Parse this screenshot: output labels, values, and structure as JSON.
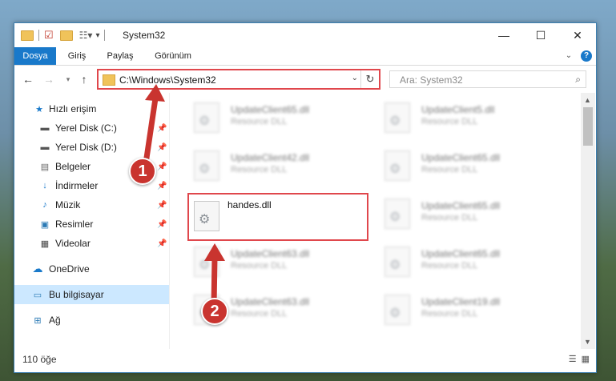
{
  "window": {
    "title": "System32",
    "controls": {
      "minimize": "—",
      "maximize": "☐",
      "close": "✕"
    }
  },
  "ribbon": {
    "tabs": [
      {
        "label": "Dosya",
        "active": true
      },
      {
        "label": "Giriş"
      },
      {
        "label": "Paylaş"
      },
      {
        "label": "Görünüm"
      }
    ],
    "expand_icon": "chevron-down-icon",
    "help_icon": "help-icon"
  },
  "navigation": {
    "address": "C:\\Windows\\System32",
    "search_placeholder": "Ara: System32"
  },
  "sidebar": {
    "items": [
      {
        "label": "Hızlı erişim",
        "icon": "star-icon",
        "pinned": false
      },
      {
        "label": "Yerel Disk (C:)",
        "icon": "drive-icon",
        "pinned": true
      },
      {
        "label": "Yerel Disk (D:)",
        "icon": "drive-icon",
        "pinned": true
      },
      {
        "label": "Belgeler",
        "icon": "documents-icon",
        "pinned": true
      },
      {
        "label": "İndirmeler",
        "icon": "download-icon",
        "pinned": true
      },
      {
        "label": "Müzik",
        "icon": "music-icon",
        "pinned": true
      },
      {
        "label": "Resimler",
        "icon": "pictures-icon",
        "pinned": true
      },
      {
        "label": "Videolar",
        "icon": "videos-icon",
        "pinned": true
      },
      {
        "label": "OneDrive",
        "icon": "cloud-icon"
      },
      {
        "label": "Bu bilgisayar",
        "icon": "computer-icon",
        "selected": true
      },
      {
        "label": "Ağ",
        "icon": "network-icon"
      }
    ]
  },
  "files": [
    {
      "name": "UpdateClient65.dll",
      "type": "Resource DLL",
      "blurred": true
    },
    {
      "name": "UpdateClient5.dll",
      "type": "Resource DLL",
      "blurred": true
    },
    {
      "name": "UpdateClient42.dll",
      "type": "Resource DLL",
      "blurred": true
    },
    {
      "name": "UpdateClient65.dll",
      "type": "Resource DLL",
      "blurred": true
    },
    {
      "name": "handes.dll",
      "type": "",
      "blurred": false,
      "highlighted": true
    },
    {
      "name": "UpdateClient65.dll",
      "type": "Resource DLL",
      "blurred": true
    },
    {
      "name": "UpdateClient63.dll",
      "type": "Resource DLL",
      "blurred": true
    },
    {
      "name": "UpdateClient65.dll",
      "type": "Resource DLL",
      "blurred": true
    },
    {
      "name": "UpdateClient63.dll",
      "type": "Resource DLL",
      "blurred": true
    },
    {
      "name": "UpdateClient19.dll",
      "type": "Resource DLL",
      "blurred": true
    }
  ],
  "status": {
    "item_count": "110 öğe"
  },
  "annotations": [
    {
      "label": "1"
    },
    {
      "label": "2"
    }
  ],
  "colors": {
    "accent": "#1979ca",
    "highlight": "#e0474c",
    "badge": "#c9342f"
  }
}
